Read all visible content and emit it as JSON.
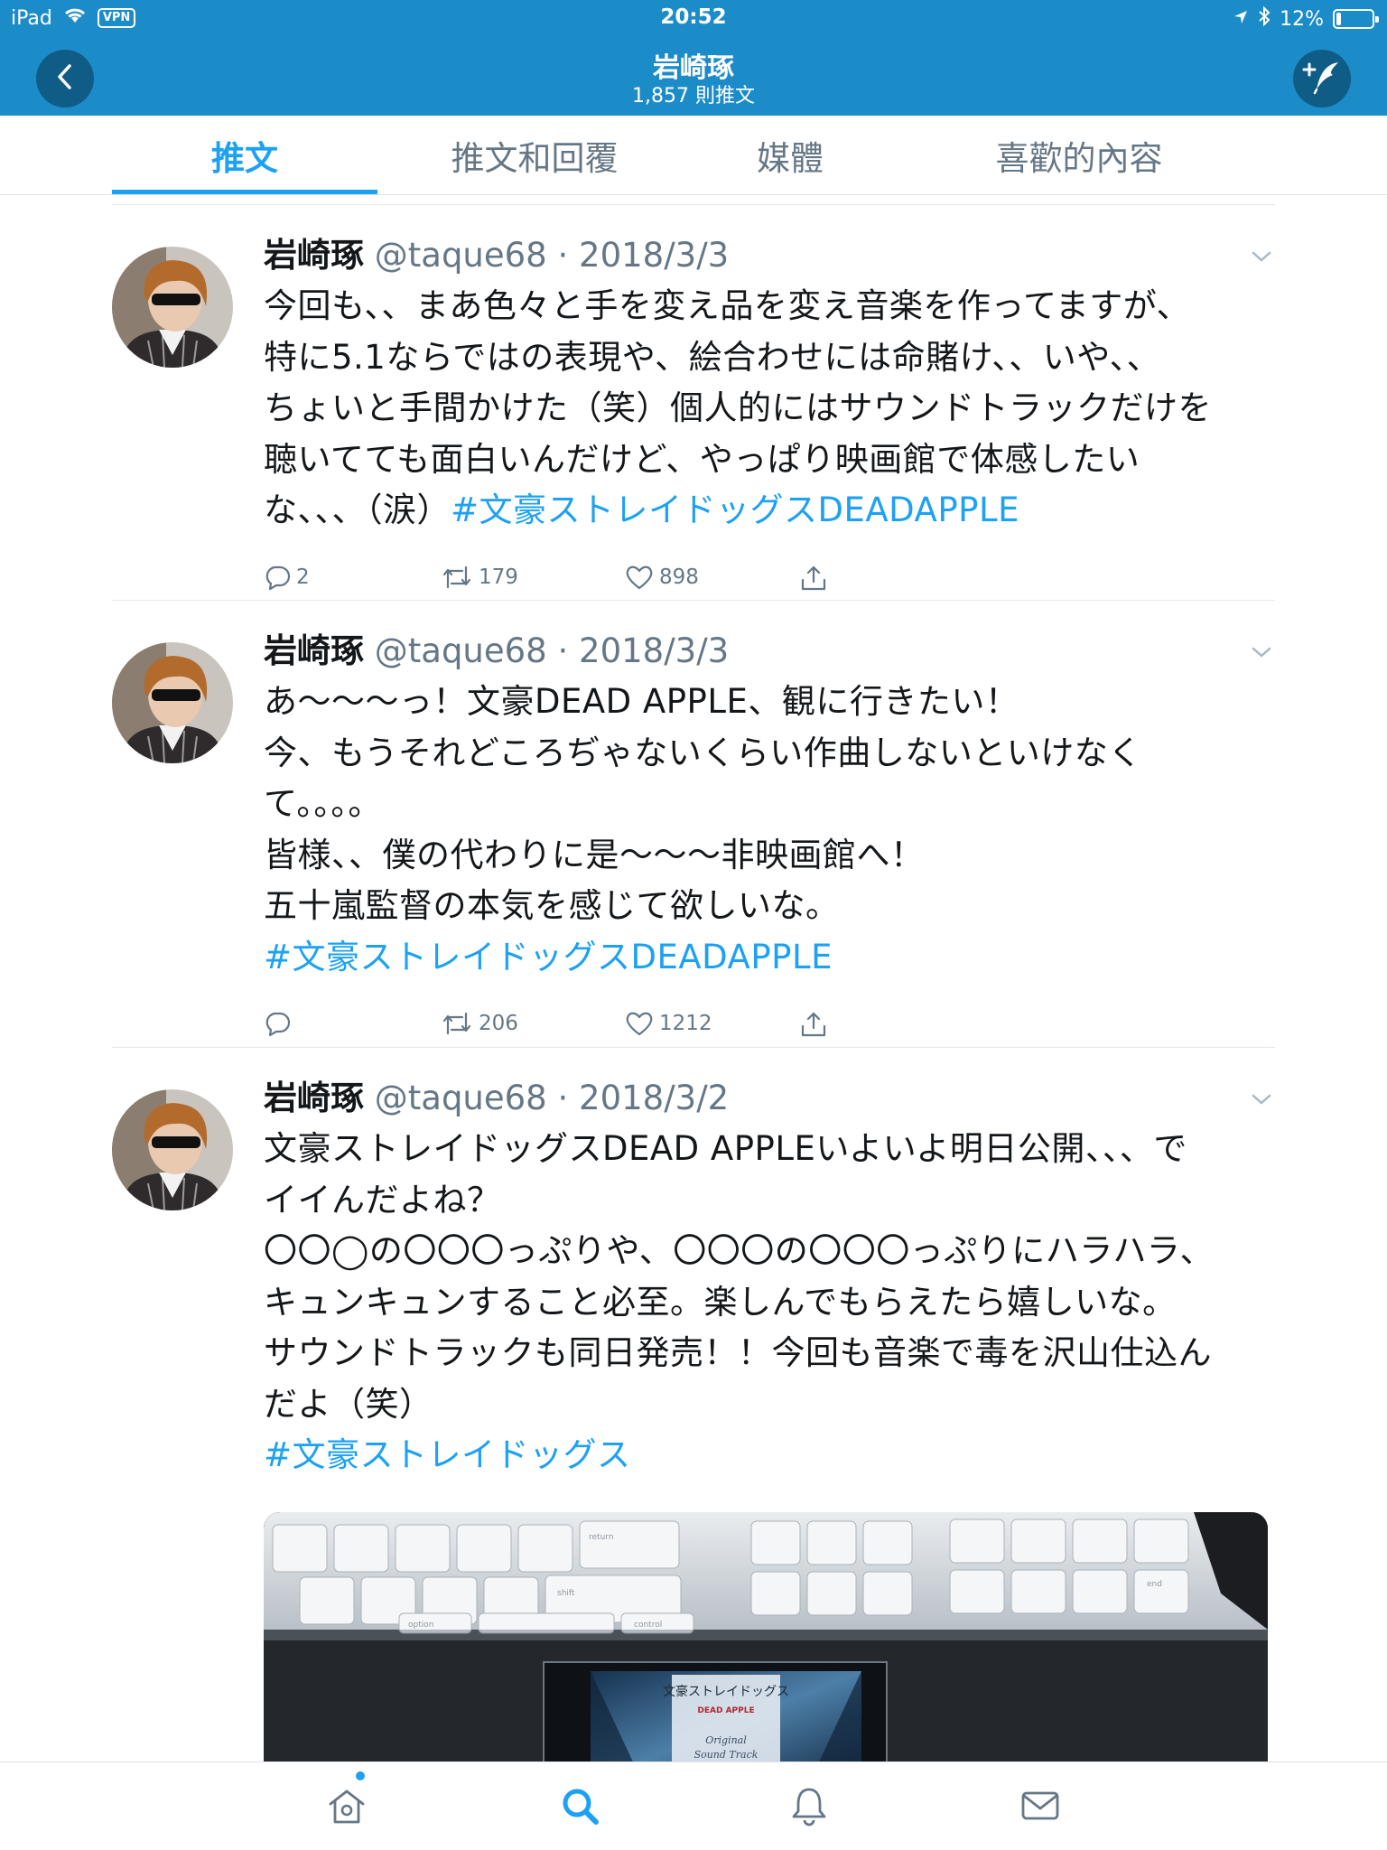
{
  "status_bar": {
    "device": "iPad",
    "vpn": "VPN",
    "time": "20:52",
    "battery": "12%",
    "battery_level": 0.12
  },
  "nav": {
    "title": "岩崎琢",
    "subtitle": "1,857 則推文"
  },
  "tabs": [
    {
      "label": "推文",
      "active": true
    },
    {
      "label": "推文和回覆",
      "active": false
    },
    {
      "label": "媒體",
      "active": false
    },
    {
      "label": "喜歡的內容",
      "active": false
    }
  ],
  "tweets": [
    {
      "author": "岩崎琢",
      "handle": "@taque68",
      "separator": "·",
      "date": "2018/3/3",
      "lines": [
        "今回も、、まあ色々と手を変え品を変え音楽を作ってますが、",
        "特に5.1ならではの表現や、絵合わせには命賭け、、いや、、",
        "ちょいと手間かけた（笑）個人的にはサウンドトラックだけを",
        "聴いてても面白いんだけど、やっぱり映画館で体感したい",
        "な、、、（涙）"
      ],
      "hashtag": "#文豪ストレイドッグスDEADAPPLE",
      "replies": "2",
      "retweets": "179",
      "likes": "898"
    },
    {
      "author": "岩崎琢",
      "handle": "@taque68",
      "separator": "·",
      "date": "2018/3/3",
      "lines": [
        "あ〜〜〜っ！文豪DEAD APPLE、観に行きたい！",
        "今、もうそれどころぢゃないくらい作曲しないといけなく",
        "て。。。。",
        "皆様、、僕の代わりに是〜〜〜非映画館へ！",
        "五十嵐監督の本気を感じて欲しいな。"
      ],
      "hashtag": "#文豪ストレイドッグスDEADAPPLE",
      "replies": "",
      "retweets": "206",
      "likes": "1212"
    },
    {
      "author": "岩崎琢",
      "handle": "@taque68",
      "separator": "·",
      "date": "2018/3/2",
      "lines": [
        "文豪ストレイドッグスDEAD APPLEいよいよ明日公開、、、で",
        "イイんだよね？",
        "〇〇◯の〇〇〇っぷりや、〇〇〇の〇〇〇っぷりにハラハラ、",
        "キュンキュンすること必至。楽しんでもらえたら嬉しいな。",
        "サウンドトラックも同日発売！！今回も音楽で毒を沢山仕込ん",
        "だよ（笑）"
      ],
      "hashtag": "#文豪ストレイドッグス",
      "media": {
        "cd_title": "文豪ストレイドッグス",
        "cd_sub1": "DEAD APPLE",
        "cd_sub2": "Original",
        "cd_sub3": "Sound Track",
        "key_labels": [
          "return",
          "shift",
          "option",
          "control",
          "end"
        ]
      }
    }
  ],
  "bottom_tabs": [
    "home-icon",
    "search-icon",
    "notifications-icon",
    "messages-icon"
  ],
  "colors": {
    "header": "#1c8cc9",
    "accent": "#1da1f2",
    "muted": "#657786"
  }
}
